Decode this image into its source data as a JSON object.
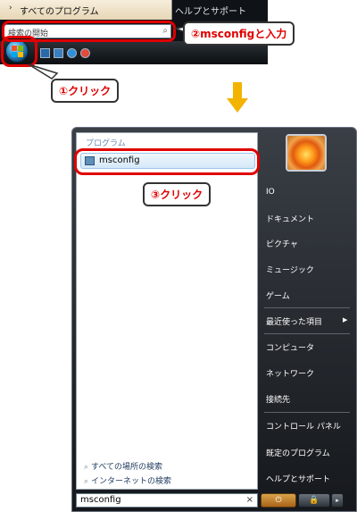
{
  "top": {
    "all_programs_arrow": "›",
    "all_programs_label": "すべてのプログラム",
    "help_label": "ヘルプとサポート",
    "search_placeholder": "検索の開始",
    "search_icon": "magnifier-icon"
  },
  "callouts": {
    "step1": "①クリック",
    "step2": "②msconfigと入力",
    "step3": "③クリック"
  },
  "start_menu": {
    "programs_heading": "プログラム",
    "result_item": "msconfig",
    "search_everywhere": "すべての場所の検索",
    "search_internet": "インターネットの検索",
    "search_value": "msconfig",
    "search_clear": "×",
    "right_items": [
      "IO",
      "ドキュメント",
      "ピクチャ",
      "ミュージック",
      "ゲーム",
      "最近使った項目",
      "コンピュータ",
      "ネットワーク",
      "接続先",
      "コントロール パネル",
      "既定のプログラム",
      "ヘルプとサポート"
    ],
    "power_symbol": "⏻",
    "lock_symbol": "🔒",
    "more_symbol": "▸"
  },
  "colors": {
    "highlight": "#e00000",
    "arrow": "#f2b400",
    "taskbar": "#0f1216",
    "result_row": "#d4e8f8"
  }
}
